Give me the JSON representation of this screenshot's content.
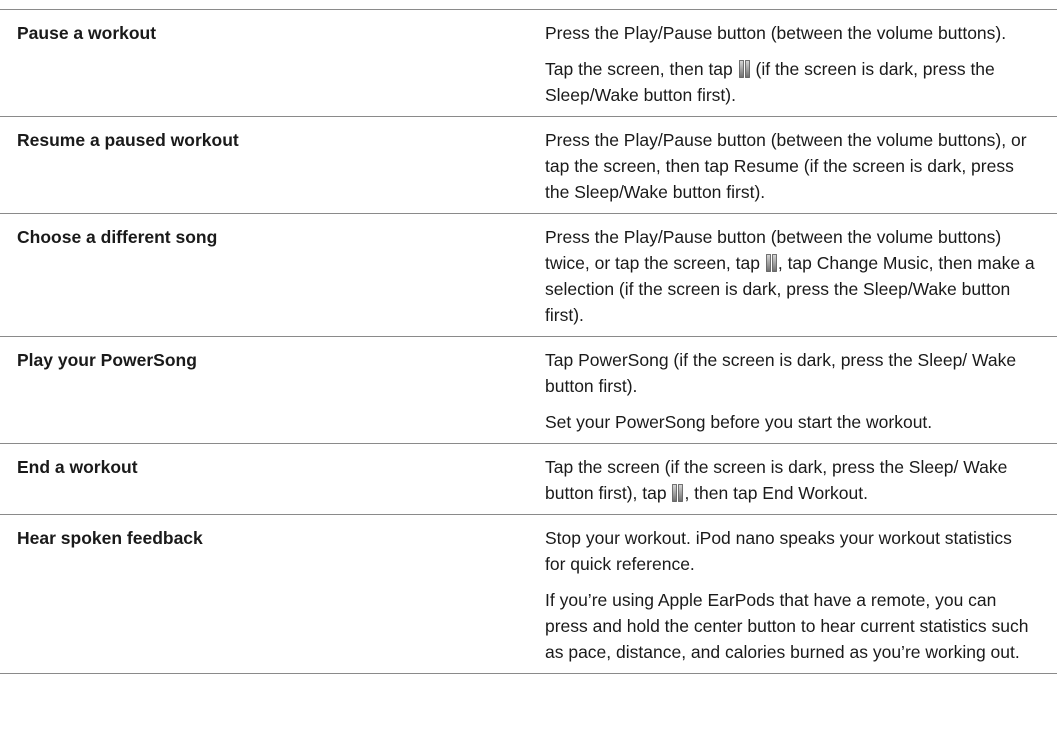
{
  "icons": {
    "pause": "pause-icon"
  },
  "rows": [
    {
      "action": "Pause a workout",
      "paras": [
        [
          "Press the Play/Pause button (between the volume buttons)."
        ],
        [
          "Tap the screen, then tap ",
          " (if the screen is dark, press the Sleep/Wake button first)."
        ]
      ]
    },
    {
      "action": "Resume a paused workout",
      "paras": [
        [
          "Press the Play/Pause button (between the volume buttons), or tap the screen, then tap Resume (if the screen is dark, press the Sleep/Wake button first)."
        ]
      ]
    },
    {
      "action": "Choose a different song",
      "paras": [
        [
          "Press the Play/Pause button (between the volume buttons) twice, or tap the screen, tap ",
          ", tap Change Music, then make a selection (if the screen is dark, press the Sleep/Wake button first)."
        ]
      ]
    },
    {
      "action": "Play your PowerSong",
      "paras": [
        [
          "Tap PowerSong (if the screen is dark, press the Sleep/ Wake button first)."
        ],
        [
          "Set your PowerSong before you start the workout."
        ]
      ]
    },
    {
      "action": "End a workout",
      "paras": [
        [
          "Tap the screen (if the screen is dark, press the Sleep/ Wake button first), tap ",
          ", then tap End Workout."
        ]
      ]
    },
    {
      "action": "Hear spoken feedback",
      "paras": [
        [
          "Stop your workout. iPod nano speaks your workout statistics for quick reference."
        ],
        [
          "If you’re using Apple EarPods that have a remote, you can press and hold the center button to hear current statistics such as pace, distance, and calories burned as you’re working out."
        ]
      ]
    }
  ]
}
